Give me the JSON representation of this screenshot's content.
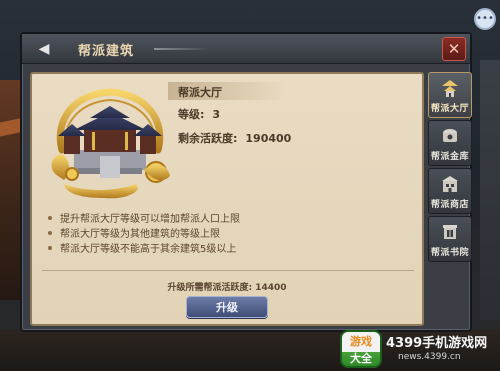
{
  "window": {
    "back_icon": "left-arrow-icon",
    "title": "帮派建筑",
    "close_icon": "close-x-icon"
  },
  "building": {
    "name": "帮派大厅",
    "level_label": "等级:",
    "level_value": "3",
    "activity_label": "剩余活跃度:",
    "activity_value": "190400",
    "image_icon": "golden-dragon-palace-illustration"
  },
  "descriptions": [
    "提升帮派大厅等级可以增加帮派人口上限",
    "帮派大厅等级为其他建筑的等级上限",
    "帮派大厅等级不能高于其余建筑5级以上"
  ],
  "requirement": {
    "label": "升级所需帮派活跃度:",
    "value": "14400"
  },
  "upgrade_button": "升级",
  "tabs": [
    {
      "label": "帮派大厅",
      "icon": "pagoda-icon",
      "active": true
    },
    {
      "label": "帮派金库",
      "icon": "treasury-icon",
      "active": false
    },
    {
      "label": "帮派商店",
      "icon": "shop-icon",
      "active": false
    },
    {
      "label": "帮派书院",
      "icon": "academy-icon",
      "active": false
    }
  ],
  "chat_icon": "chat-bubble-icon",
  "watermark": {
    "badge_top": "游戏",
    "badge_bottom": "大全",
    "site_name": "4399手机游戏网",
    "site_url": "news.4399.cn"
  },
  "colors": {
    "parchment": "#e6d8bc",
    "frame": "#3b3f45",
    "close_red": "#8a2c25",
    "upgrade_blue": "#4f5e8c",
    "text_brown": "#4b3a28"
  }
}
